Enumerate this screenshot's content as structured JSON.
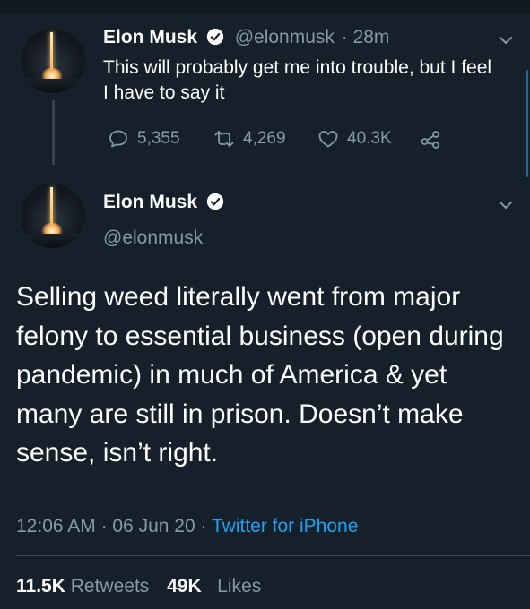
{
  "reply_tweet": {
    "name": "Elon Musk",
    "handle": "@elonmusk",
    "time": "· 28m",
    "text": "This will probably get me into trouble, but I feel I have to say it",
    "replies": "5,355",
    "retweets": "4,269",
    "likes": "40.3K"
  },
  "main_tweet": {
    "name": "Elon Musk",
    "handle": "@elonmusk",
    "text": "Selling weed literally went from major felony to essential business (open during pandemic) in much of America & yet many are still in prison. Doesn’t make sense, isn’t right.",
    "time": "12:06 AM",
    "date": "06 Jun 20",
    "separator": "·",
    "source": "Twitter for iPhone",
    "retweet_count": "11.5K",
    "retweet_label": "Retweets",
    "like_count": "49K",
    "like_label": "Likes"
  },
  "colors": {
    "background": "#15202b",
    "secondary_text": "#8899a6",
    "accent": "#1da1f2",
    "divider": "#38444d"
  },
  "icons": [
    "verified-badge-icon",
    "chevron-down-icon",
    "reply-icon",
    "retweet-icon",
    "like-icon",
    "share-icon"
  ]
}
